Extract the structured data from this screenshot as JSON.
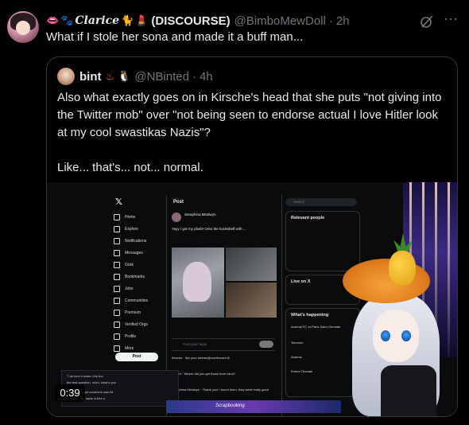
{
  "tweet": {
    "display_name_text": "Clarice",
    "display_name_suffix": "(DISCOURSE)",
    "handle": "@BimboMewDoll",
    "time": "2h",
    "text": "What if I stole her sona and made it a buff man..."
  },
  "quote": {
    "name": "bint",
    "handle": "@NBinted",
    "time": "4h",
    "paragraphs": [
      "Also what exactly goes on in Kirsche's head that she puts \"not giving into the Twitter mob\" over \"not being seen to endorse actual I love Hitler look at my cool swastikas Nazis\"?",
      "Like... that's... not... normal."
    ]
  },
  "media": {
    "duration": "0:39",
    "screen": {
      "sidebar": [
        "Home",
        "Explore",
        "Notifications",
        "Messages",
        "Grok",
        "Bookmarks",
        "Jobs",
        "Communities",
        "Premium",
        "Verified Orgs",
        "Profile",
        "More"
      ],
      "post_button": "Post",
      "post_title": "Post",
      "post_author": "Seraphina Mindwyn",
      "post_text": "Yayy I got my plush! Onto the bookshelf with …",
      "reply_placeholder": "Post your reply",
      "reply_button": "Reply",
      "comments": [
        "Kirsche · like your stream@overfuzzed ill",
        "Tucker · Where did you get those from mind?",
        "Seraphina Mindwyn · Thank you! I found them, they were really good"
      ],
      "search_placeholder": "Search",
      "relevant_header": "Relevant people",
      "live_header": "Live on X",
      "happening_header": "What's happening",
      "happening_items": [
        "Arsenal FC vs Paris Saint-Germain",
        "Tommen",
        "Arsenal",
        "Emma Thomas"
      ],
      "overlay_lines": [
        "\"I do love it when i tho tho",
        "the real question, mom, what'd you",
        "I'd even bought someone was hit",
        "crazy lol, the nazis is bee u"
      ],
      "bottom_label": "Scrapbooking"
    }
  },
  "colors": {
    "bg": "#000000",
    "text": "#e7e9ea",
    "muted": "#71767b",
    "border": "#333639"
  },
  "icons": [
    "grok-icon",
    "more-icon",
    "fire-emoji",
    "penguin-emoji",
    "lips-emoji",
    "paw-emoji",
    "cat-emoji",
    "lipstick-emoji"
  ]
}
